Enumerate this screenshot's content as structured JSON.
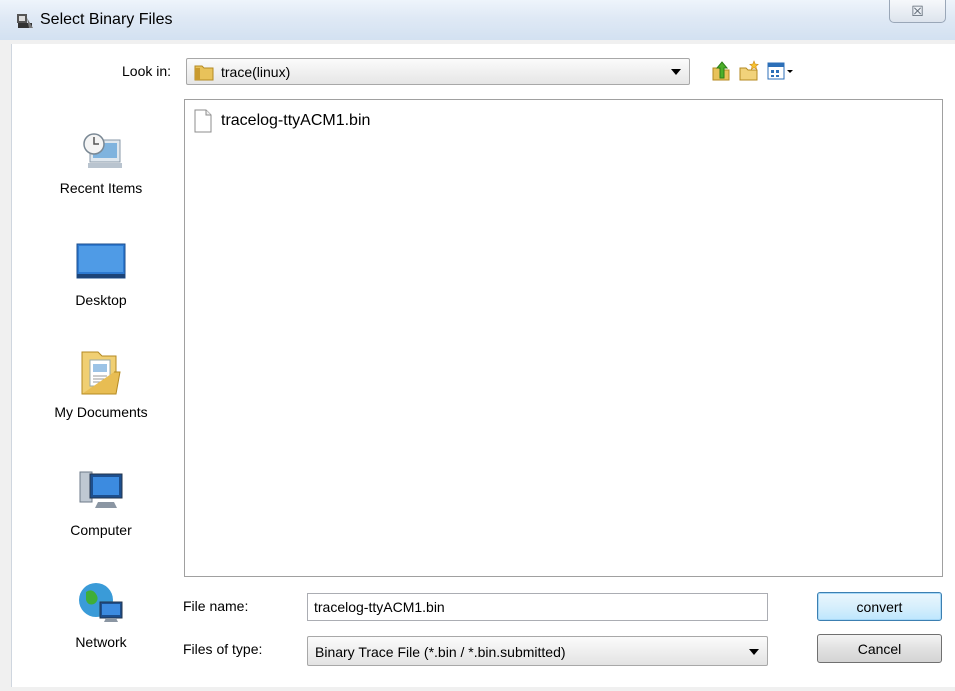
{
  "window": {
    "title": "Select Binary Files",
    "close_symbol": "☒"
  },
  "look_in": {
    "label": "Look in:",
    "value": "trace(linux)"
  },
  "toolbar": {
    "icons": [
      "up-one-level-icon",
      "create-new-folder-icon",
      "view-menu-icon"
    ]
  },
  "places": [
    {
      "label": "Recent Items",
      "icon": "recent-items-icon"
    },
    {
      "label": "Desktop",
      "icon": "desktop-icon"
    },
    {
      "label": "My Documents",
      "icon": "my-documents-icon"
    },
    {
      "label": "Computer",
      "icon": "computer-icon"
    },
    {
      "label": "Network",
      "icon": "network-icon"
    }
  ],
  "files": [
    {
      "name": "tracelog-ttyACM1.bin",
      "icon": "file-icon"
    }
  ],
  "file_name": {
    "label": "File name:",
    "value": "tracelog-ttyACM1.bin"
  },
  "file_type": {
    "label": "Files of type:",
    "value": "Binary Trace File (*.bin / *.bin.submitted)"
  },
  "buttons": {
    "convert": "convert",
    "cancel": "Cancel"
  }
}
